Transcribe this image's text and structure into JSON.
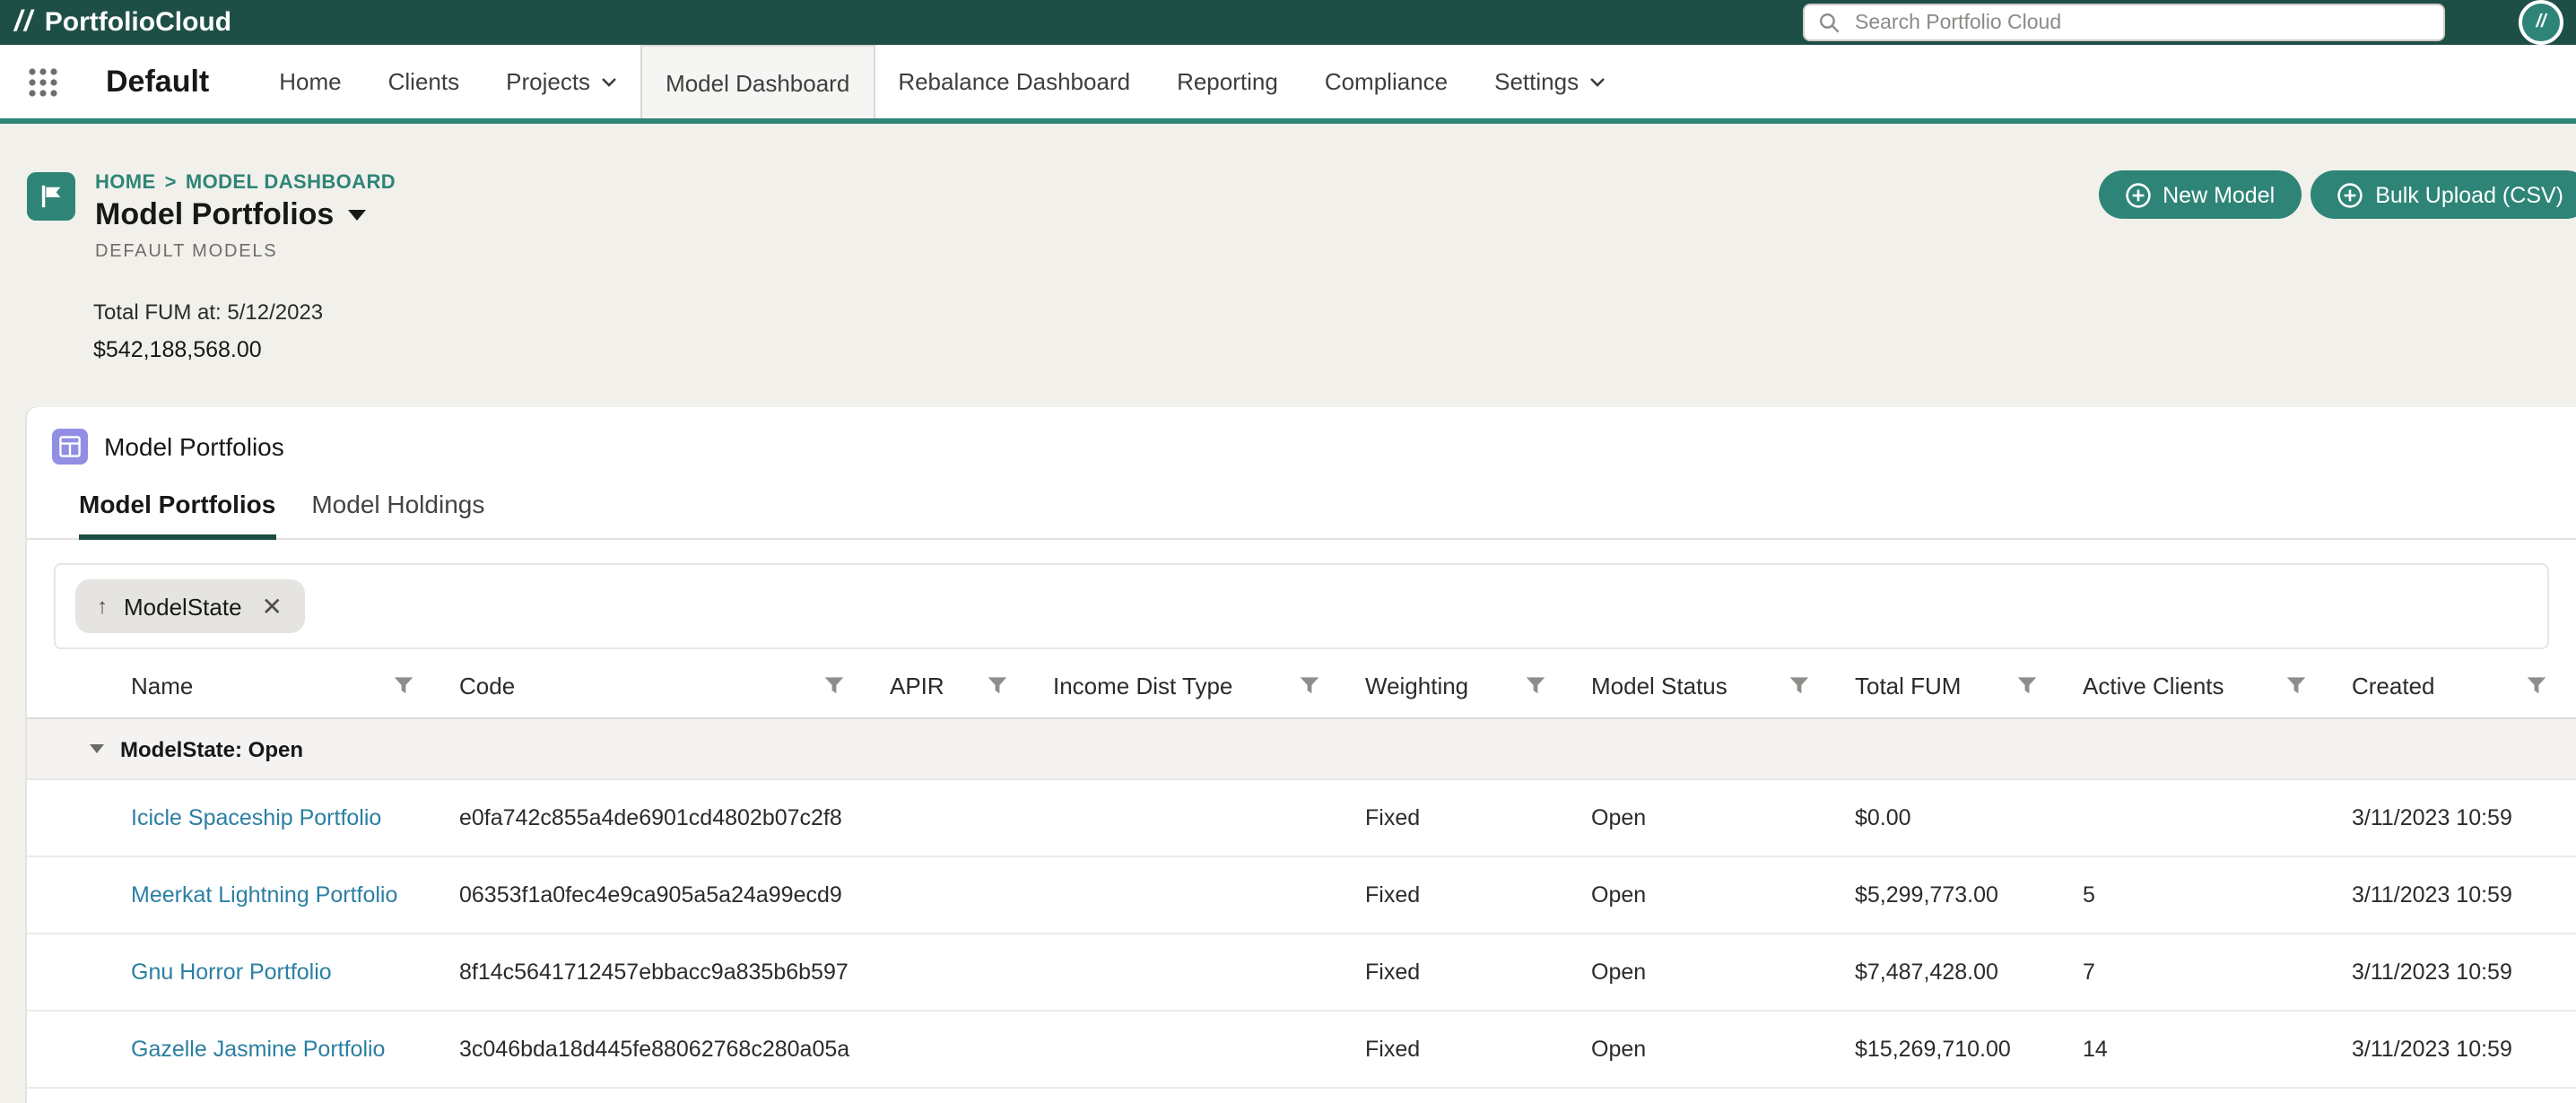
{
  "theme": {
    "header_bg": "#1d4f46",
    "accent_teal": "#2e8577",
    "page_bg": "#f2f0eb",
    "link_blue": "#2b7fa3",
    "card_icon_purple": "#918ee4",
    "active_tab_underline": "#1b4d44"
  },
  "header": {
    "brand_prefix": "//",
    "brand": "PortfolioCloud",
    "search_placeholder": "Search Portfolio Cloud",
    "badge_glyph": "//"
  },
  "nav": {
    "app_name": "Default",
    "items": [
      {
        "label": "Home"
      },
      {
        "label": "Clients"
      },
      {
        "label": "Projects",
        "has_menu": true
      },
      {
        "label": "Model Dashboard",
        "active": true
      },
      {
        "label": "Rebalance Dashboard"
      },
      {
        "label": "Reporting"
      },
      {
        "label": "Compliance"
      },
      {
        "label": "Settings",
        "has_menu": true
      }
    ]
  },
  "page_header": {
    "breadcrumb": [
      "HOME",
      "MODEL DASHBOARD"
    ],
    "breadcrumb_separator": ">",
    "title": "Model Portfolios",
    "subtitle": "DEFAULT MODELS",
    "fum_label": "Total FUM at: 5/12/2023",
    "fum_value": "$542,188,568.00",
    "buttons": [
      {
        "label": "New Model"
      },
      {
        "label": "Bulk Upload (CSV)"
      }
    ]
  },
  "card": {
    "title": "Model Portfolios",
    "tabs": [
      {
        "label": "Model Portfolios",
        "active": true
      },
      {
        "label": "Model Holdings",
        "active": false
      }
    ],
    "sort_chip": {
      "label": "ModelState",
      "direction": "ascending"
    },
    "table": {
      "columns": [
        "Name",
        "Code",
        "APIR",
        "Income Dist Type",
        "Weighting",
        "Model Status",
        "Total FUM",
        "Active Clients",
        "Created"
      ],
      "group_label": "ModelState: Open",
      "rows": [
        {
          "name": "Icicle Spaceship Portfolio",
          "code": "e0fa742c855a4de6901cd4802b07c2f8",
          "apir": "",
          "income_dist_type": "",
          "weighting": "Fixed",
          "model_status": "Open",
          "total_fum": "$0.00",
          "active_clients": "",
          "created": "3/11/2023 10:59"
        },
        {
          "name": "Meerkat Lightning Portfolio",
          "code": "06353f1a0fec4e9ca905a5a24a99ecd9",
          "apir": "",
          "income_dist_type": "",
          "weighting": "Fixed",
          "model_status": "Open",
          "total_fum": "$5,299,773.00",
          "active_clients": "5",
          "created": "3/11/2023 10:59"
        },
        {
          "name": "Gnu Horror Portfolio",
          "code": "8f14c5641712457ebbacc9a835b6b597",
          "apir": "",
          "income_dist_type": "",
          "weighting": "Fixed",
          "model_status": "Open",
          "total_fum": "$7,487,428.00",
          "active_clients": "7",
          "created": "3/11/2023 10:59"
        },
        {
          "name": "Gazelle Jasmine Portfolio",
          "code": "3c046bda18d445fe88062768c280a05a",
          "apir": "",
          "income_dist_type": "",
          "weighting": "Fixed",
          "model_status": "Open",
          "total_fum": "$15,269,710.00",
          "active_clients": "14",
          "created": "3/11/2023 10:59"
        }
      ]
    }
  }
}
